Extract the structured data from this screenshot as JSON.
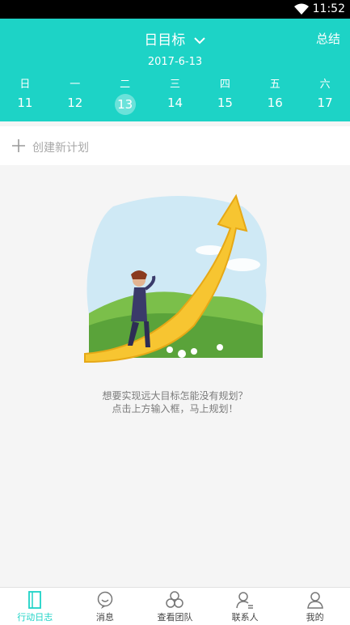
{
  "status_bar": {
    "time": "11:52",
    "icon": "wifi-icon"
  },
  "header": {
    "title": "日目标",
    "summary_label": "总结",
    "date": "2017-6-13",
    "weekdays": [
      "日",
      "一",
      "二",
      "三",
      "四",
      "五",
      "六"
    ],
    "days": [
      "11",
      "12",
      "13",
      "14",
      "15",
      "16",
      "17"
    ],
    "selected_day": "13",
    "accent": "#1dd3c6"
  },
  "create": {
    "label": "创建新计划",
    "icon": "plus-icon"
  },
  "empty_state": {
    "line1": "想要实现远大目标怎能没有规划？",
    "line2": "点击上方输入框，马上规划！"
  },
  "tabbar": {
    "items": [
      {
        "label": "行动日志",
        "icon": "journal-icon",
        "active": true
      },
      {
        "label": "消息",
        "icon": "message-icon",
        "active": false
      },
      {
        "label": "查看团队",
        "icon": "team-icon",
        "active": false
      },
      {
        "label": "联系人",
        "icon": "contacts-icon",
        "active": false
      },
      {
        "label": "我的",
        "icon": "profile-icon",
        "active": false
      }
    ]
  }
}
